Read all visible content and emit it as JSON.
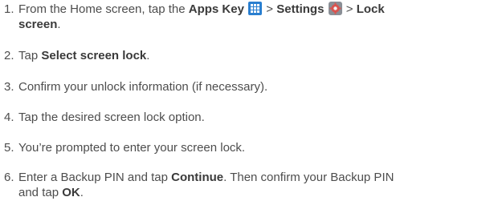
{
  "steps": [
    {
      "number": "1.",
      "pre": "From the Home screen, tap the ",
      "apps_key": "Apps Key",
      "sep1": " > ",
      "settings": "Settings",
      "sep2": " > ",
      "lock_line1": "Lock",
      "lock_line2": "screen",
      "end": "."
    },
    {
      "number": "2.",
      "pre": "Tap ",
      "bold": "Select screen lock",
      "end": "."
    },
    {
      "number": "3.",
      "text": "Confirm your unlock information (if necessary)."
    },
    {
      "number": "4.",
      "text": "Tap the desired screen lock option."
    },
    {
      "number": "5.",
      "text": "You’re prompted to enter your screen lock."
    },
    {
      "number": "6.",
      "pre": "Enter a Backup PIN and tap ",
      "bold1": "Continue",
      "mid": ". Then confirm your Backup PIN",
      "line2_pre": "and tap ",
      "bold2": "OK",
      "end": "."
    }
  ],
  "icons": {
    "apps_key": "apps-grid-icon",
    "settings": "settings-gear-icon"
  },
  "colors": {
    "text": "#4d4d4d",
    "apps_icon": "#2a7fd0",
    "settings_icon": "#8a8f96"
  }
}
